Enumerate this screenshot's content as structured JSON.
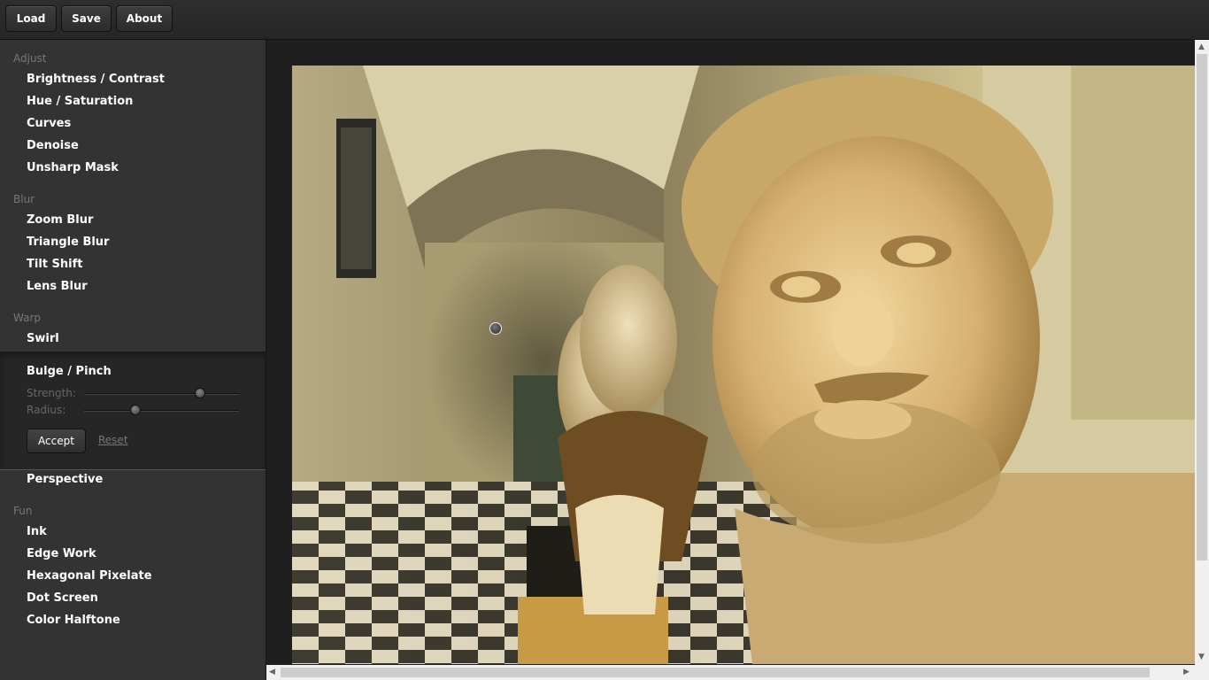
{
  "toolbar": {
    "load": "Load",
    "save": "Save",
    "about": "About"
  },
  "sidebar": {
    "adjust": {
      "title": "Adjust",
      "items": [
        "Brightness / Contrast",
        "Hue / Saturation",
        "Curves",
        "Denoise",
        "Unsharp Mask"
      ]
    },
    "blur": {
      "title": "Blur",
      "items": [
        "Zoom Blur",
        "Triangle Blur",
        "Tilt Shift",
        "Lens Blur"
      ]
    },
    "warp": {
      "title": "Warp",
      "items": [
        "Swirl",
        "Bulge / Pinch",
        "Perspective"
      ]
    },
    "fun": {
      "title": "Fun",
      "items": [
        "Ink",
        "Edge Work",
        "Hexagonal Pixelate",
        "Dot Screen",
        "Color Halftone"
      ]
    }
  },
  "active_filter": {
    "name": "Bulge / Pinch",
    "strength_label": "Strength:",
    "strength_value": 0.75,
    "radius_label": "Radius:",
    "radius_value": 0.33,
    "accept_label": "Accept",
    "reset_label": "Reset"
  },
  "colors": {
    "accent": "#ffffff",
    "panel": "#333333",
    "active_panel": "#262626"
  },
  "icons": {
    "bulge_center_handle": "circle-handle",
    "scroll_up": "arrow-up",
    "scroll_down": "arrow-down",
    "scroll_left": "arrow-left",
    "scroll_right": "arrow-right"
  }
}
